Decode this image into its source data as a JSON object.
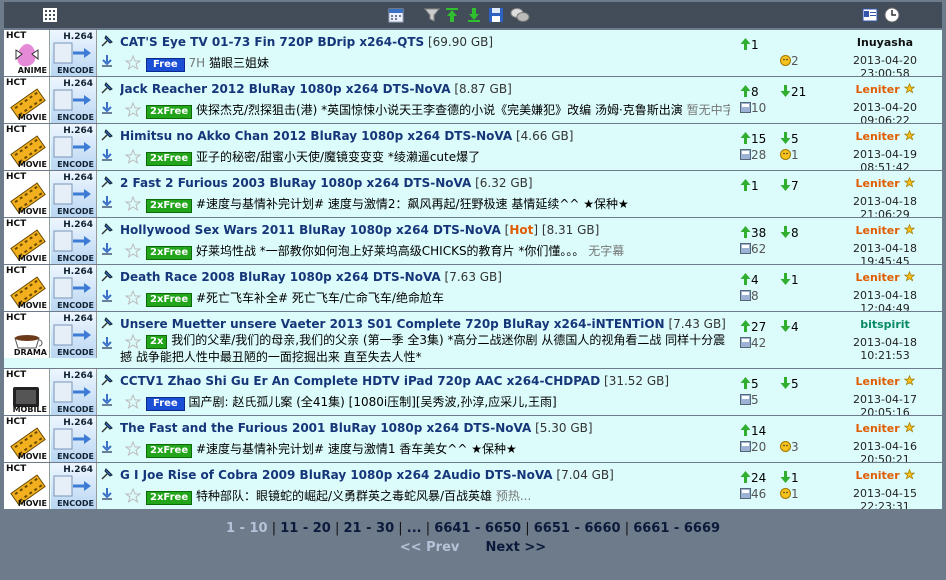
{
  "header": {
    "icons": [
      "grid-icon",
      "calendar-icon",
      "filter-icon",
      "sort-up-icon",
      "sort-down-icon",
      "save-icon",
      "chat-icon",
      "id-card-icon",
      "clock-icon"
    ]
  },
  "rows": [
    {
      "cat_hct": "HCT",
      "cat": "ANIME",
      "enc_a": "H.264",
      "enc_b": "ENCODE",
      "name": "CAT'S Eye TV 01-73 Fin 720P BDrip x264-QTS",
      "size": "[69.90 GB]",
      "hot": "",
      "tag": "Free",
      "tag_type": "free",
      "tag_extra": "7H",
      "desc": "猫眼三姐妹",
      "gray": "",
      "up": "1",
      "down": "",
      "snatched": "",
      "comments": "2",
      "owner": "Inuyasha",
      "owner_color": "black",
      "date": "2013-04-20 23:00:58"
    },
    {
      "cat_hct": "HCT",
      "cat": "MOVIE",
      "enc_a": "H.264",
      "enc_b": "ENCODE",
      "name": "Jack Reacher 2012 BluRay 1080p x264 DTS-NoVA",
      "size": "[8.87 GB]",
      "hot": "",
      "tag": "2xFree",
      "tag_type": "2x",
      "tag_extra": "",
      "desc": "侠探杰克/烈探狙击(港) *英国惊悚小说天王李查德的小说《完美嫌犯》改编 汤姆·克鲁斯出演",
      "gray": "暂无中字",
      "up": "8",
      "down": "21",
      "snatched": "10",
      "comments": "",
      "owner": "Leniter",
      "owner_color": "orange",
      "date": "2013-04-20 09:06:22"
    },
    {
      "cat_hct": "HCT",
      "cat": "MOVIE",
      "enc_a": "H.264",
      "enc_b": "ENCODE",
      "name": "Himitsu no Akko Chan 2012 BluRay 1080p x264 DTS-NoVA",
      "size": "[4.66 GB]",
      "hot": "",
      "tag": "2xFree",
      "tag_type": "2x",
      "tag_extra": "",
      "desc": "亚子的秘密/甜蜜小天使/魔镜变变变 *绫濑遥cute爆了",
      "gray": "",
      "up": "15",
      "down": "5",
      "snatched": "28",
      "comments": "1",
      "owner": "Leniter",
      "owner_color": "orange",
      "date": "2013-04-19 08:51:42"
    },
    {
      "cat_hct": "HCT",
      "cat": "MOVIE",
      "enc_a": "H.264",
      "enc_b": "ENCODE",
      "name": "2 Fast 2 Furious 2003 BluRay 1080p x264 DTS-NoVA",
      "size": "[6.32 GB]",
      "hot": "",
      "tag": "2xFree",
      "tag_type": "2x",
      "tag_extra": "",
      "desc": "#速度与基情补完计划# 速度与激情2：飙风再起/狂野极速 基情延续^^ ★保种★",
      "gray": "",
      "up": "1",
      "down": "7",
      "snatched": "",
      "comments": "",
      "owner": "Leniter",
      "owner_color": "orange",
      "date": "2013-04-18 21:06:29"
    },
    {
      "cat_hct": "HCT",
      "cat": "MOVIE",
      "enc_a": "H.264",
      "enc_b": "ENCODE",
      "name": "Hollywood Sex Wars 2011 BluRay 1080p x264 DTS-NoVA",
      "size": "[8.31 GB]",
      "hot": "Hot",
      "tag": "2xFree",
      "tag_type": "2x",
      "tag_extra": "",
      "desc": "好莱坞性战 *一部教你如何泡上好莱坞高级CHICKS的教育片 *你们懂。。。",
      "gray": "无字幕",
      "up": "38",
      "down": "8",
      "snatched": "62",
      "comments": "",
      "owner": "Leniter",
      "owner_color": "orange",
      "date": "2013-04-18 19:45:45"
    },
    {
      "cat_hct": "HCT",
      "cat": "MOVIE",
      "enc_a": "H.264",
      "enc_b": "ENCODE",
      "name": "Death Race 2008 BluRay 1080p x264 DTS-NoVA",
      "size": "[7.63 GB]",
      "hot": "",
      "tag": "2xFree",
      "tag_type": "2x",
      "tag_extra": "",
      "desc": "#死亡飞车补全# 死亡飞车/亡命飞车/绝命尬车",
      "gray": "",
      "up": "4",
      "down": "1",
      "snatched": "8",
      "comments": "",
      "owner": "Leniter",
      "owner_color": "orange",
      "date": "2013-04-18 12:04:49"
    },
    {
      "cat_hct": "HCT",
      "cat": "DRAMA",
      "enc_a": "H.264",
      "enc_b": "ENCODE",
      "name": "Unsere Muetter unsere Vaeter 2013 S01 Complete 720p BluRay x264-iNTENTiON",
      "size": "[7.43 GB]",
      "hot": "",
      "tag": "2x",
      "tag_type": "2x",
      "tag_extra": "",
      "desc": "我们的父辈/我们的母亲,我们的父亲 (第一季 全3集) *高分二战迷你剧 从德国人的视角看二战 同样十分震撼 战争能把人性中最丑陋的一面挖掘出来 直至失去人性*",
      "gray": "",
      "up": "27",
      "down": "4",
      "snatched": "42",
      "comments": "",
      "owner": "bitspirit",
      "owner_color": "green",
      "date": "2013-04-18 10:21:53",
      "tall": true
    },
    {
      "cat_hct": "HCT",
      "cat": "MOBILE",
      "enc_a": "H.264",
      "enc_b": "ENCODE",
      "name": "CCTV1 Zhao Shi Gu Er An Complete HDTV iPad 720p AAC x264-CHDPAD",
      "size": "[31.52 GB]",
      "hot": "",
      "tag": "Free",
      "tag_type": "free",
      "tag_extra": "",
      "desc": "国产剧: 赵氏孤儿案 (全41集) [1080i压制][吴秀波,孙淳,应采儿,王雨]",
      "gray": "",
      "up": "5",
      "down": "5",
      "snatched": "5",
      "comments": "",
      "owner": "Leniter",
      "owner_color": "orange",
      "date": "2013-04-17 20:05:16"
    },
    {
      "cat_hct": "HCT",
      "cat": "MOVIE",
      "enc_a": "H.264",
      "enc_b": "ENCODE",
      "name": "The Fast and the Furious 2001 BluRay 1080p x264 DTS-NoVA",
      "size": "[5.30 GB]",
      "hot": "",
      "tag": "2xFree",
      "tag_type": "2x",
      "tag_extra": "",
      "desc": "#速度与基情补完计划# 速度与激情1 香车美女^^ ★保种★",
      "gray": "",
      "up": "14",
      "down": "",
      "snatched": "20",
      "comments": "3",
      "owner": "Leniter",
      "owner_color": "orange",
      "date": "2013-04-16 20:50:21"
    },
    {
      "cat_hct": "HCT",
      "cat": "MOVIE",
      "enc_a": "H.264",
      "enc_b": "ENCODE",
      "name": "G I Joe Rise of Cobra 2009 BluRay 1080p x264 2Audio DTS-NoVA",
      "size": "[7.04 GB]",
      "hot": "",
      "tag": "2xFree",
      "tag_type": "2x",
      "tag_extra": "",
      "desc": "特种部队：眼镜蛇的崛起/义勇群英之毒蛇风暴/百战英雄",
      "gray": "预热...",
      "up": "24",
      "down": "1",
      "snatched": "46",
      "comments": "1",
      "owner": "Leniter",
      "owner_color": "orange",
      "date": "2013-04-15 22:23:31"
    }
  ],
  "pager": {
    "current": "1 - 10",
    "pages": [
      "11 - 20",
      "21 - 30",
      "...",
      "6641 - 6650",
      "6651 - 6660",
      "6661 - 6669"
    ],
    "prev": "<< Prev",
    "next": "Next >>"
  }
}
